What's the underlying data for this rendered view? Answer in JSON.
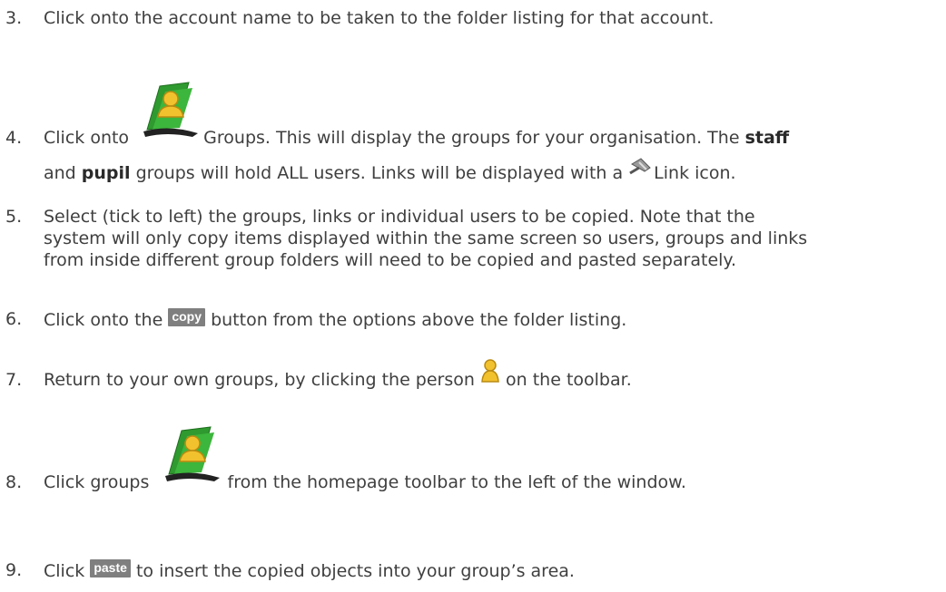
{
  "steps": [
    {
      "number": "3.",
      "text": "Click onto the account name to be taken to the folder listing for that account."
    },
    {
      "number": "4.",
      "before": "Click onto",
      "after": "Groups. This will display the groups for your organisation. The",
      "bold1": "staff",
      "line2_start": "and",
      "bold2": "pupil",
      "line2_end": "groups will hold ALL users. Links will be displayed with a",
      "line2_after_icon": "Link icon.",
      "icon1": "groups-folder-icon",
      "icon2": "link-icon"
    },
    {
      "number": "5.",
      "lines": [
        "Select (tick to left) the groups, links or individual users to be copied. Note that the",
        "system will only copy items displayed within the same screen so users, groups and links",
        "from inside different group folders will need to be copied and pasted separately."
      ]
    },
    {
      "number": "6.",
      "before": "Click onto the",
      "button": "copy",
      "after": "button from the options above the folder listing."
    },
    {
      "number": "7.",
      "before": "Return to your own groups, by clicking the person",
      "after": "on the toolbar.",
      "icon": "person-icon"
    },
    {
      "number": "8.",
      "before": "Click groups",
      "after": "from the homepage toolbar to the left of the window.",
      "icon": "groups-folder-icon"
    },
    {
      "number": "9.",
      "before": "Click",
      "button": "paste",
      "after": "to insert the copied objects into your group’s area."
    }
  ],
  "colors": {
    "text": "#3f3f3f",
    "button_bg": "#7f7f7f",
    "folder_green": "#2f9a2f",
    "person_yellow": "#f2c12e"
  }
}
